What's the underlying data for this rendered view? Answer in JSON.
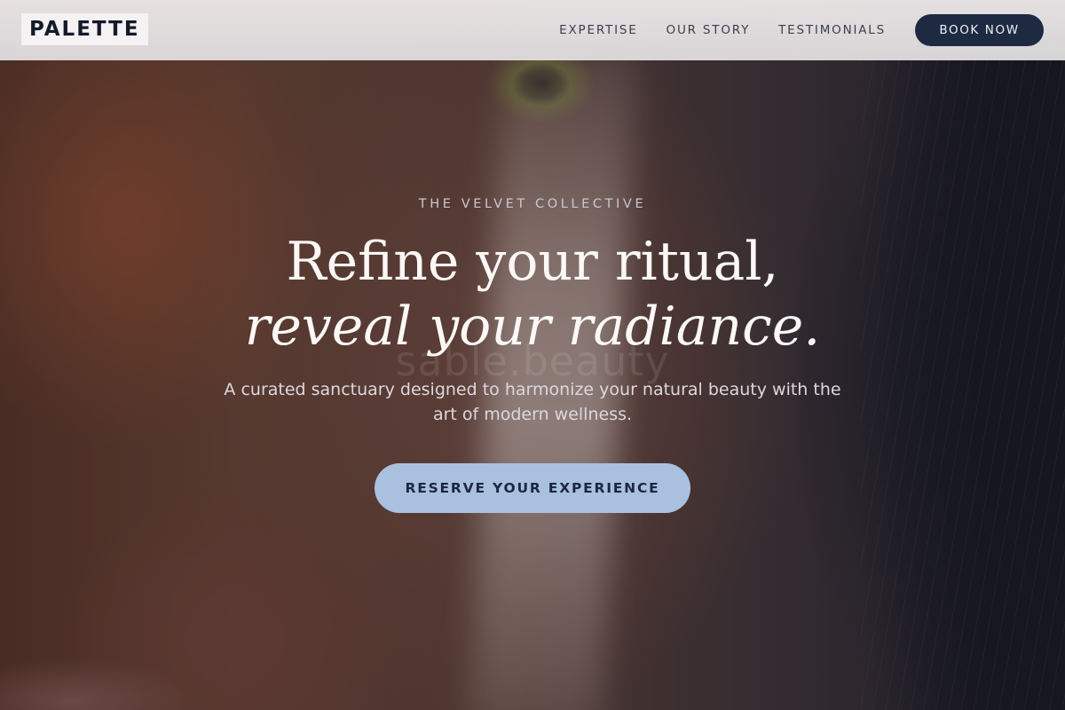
{
  "header": {
    "logo": "PALETTE",
    "nav": [
      {
        "label": "EXPERTISE"
      },
      {
        "label": "OUR STORY"
      },
      {
        "label": "TESTIMONIALS"
      }
    ],
    "cta_label": "BOOK NOW"
  },
  "hero": {
    "eyebrow": "THE VELVET COLLECTIVE",
    "headline_line1": "Refine your ritual,",
    "headline_line2": "reveal your radiance.",
    "watermark": "sable.beauty",
    "subtext": "A curated sanctuary designed to harmonize your natural beauty with the art of modern wellness.",
    "cta_label": "RESERVE YOUR EXPERIENCE"
  },
  "colors": {
    "navy": "#1e2a42",
    "accent_blue": "#a9c0df",
    "header_bg": "#e6e3e4"
  }
}
